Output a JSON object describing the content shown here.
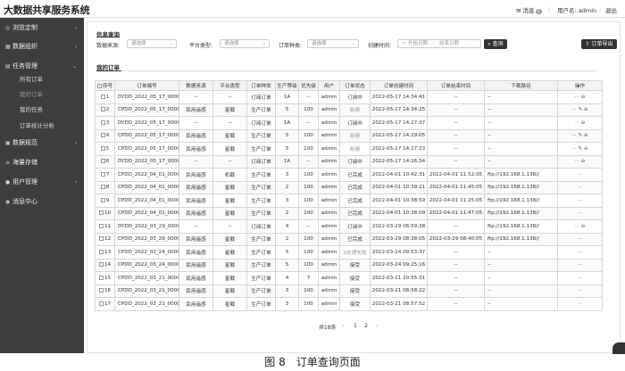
{
  "header": {
    "logo": "大数据共享服务系统",
    "msg_label": "消息",
    "msg_count": "0",
    "user_label": "用户名: admin",
    "exit_label": "退出"
  },
  "sidebar": {
    "items": [
      {
        "label": "浏览定制",
        "arrow": "›"
      },
      {
        "label": "数据组织",
        "arrow": "›"
      },
      {
        "label": "任务管理",
        "arrow": "⌄"
      },
      {
        "label": "所有订单"
      },
      {
        "label": "我的订单"
      },
      {
        "label": "我的任务"
      },
      {
        "label": "订单统计分析"
      },
      {
        "label": "数据规范",
        "arrow": "›"
      },
      {
        "label": "海量存储"
      },
      {
        "label": "用户管理",
        "arrow": "›"
      },
      {
        "label": "消息中心"
      }
    ]
  },
  "filters": {
    "section_title": "信息查询",
    "source_label": "数据来源:",
    "source_ph": "请选择",
    "platform_label": "平台类型:",
    "platform_ph": "请选择",
    "ordertype_label": "订单种类:",
    "ordertype_ph": "请选择",
    "created_label": "创建时间:",
    "start_ph": "开始日期",
    "to": "-",
    "end_ph": "结束日期",
    "search_btn": "查询",
    "export_btn": "订单导出"
  },
  "orders": {
    "section_title": "我的订单",
    "headers": [
      "序号",
      "订单编号",
      "数据来源",
      "平台类型",
      "订单种类",
      "生产等级",
      "优先级",
      "用户",
      "订单状态",
      "订单创建时间",
      "订单结束时间",
      "下载路径",
      "操作"
    ],
    "rows": [
      [
        "1",
        "DYDD_2022_05_17_000002",
        "--",
        "--",
        "订阅订单",
        "1A",
        "--",
        "admin",
        "订阅中",
        "2022-05-17 14:34:41",
        "--",
        "--",
        "···  ⊖"
      ],
      [
        "2",
        "CPDD_2022_05_17_000002",
        "民用遥感",
        "星载",
        "生产订单",
        "5",
        "100",
        "admin",
        "新建",
        "2022-05-17 14:34:25",
        "--",
        "--",
        "···  ✎  ⊖"
      ],
      [
        "3",
        "DYDD_2022_05_17_000001",
        "--",
        "--",
        "订阅订单",
        "1A",
        "--",
        "admin",
        "订阅中",
        "2022-05-17 14:27:37",
        "--",
        "--",
        "···  ⊖"
      ],
      [
        "4",
        "CPDD_2022_05_17_000001",
        "民用遥感",
        "星载",
        "生产订单",
        "5",
        "100",
        "admin",
        "新建",
        "2022-05-17 14:29:05",
        "--",
        "--",
        "···  ✎  ⊖"
      ],
      [
        "5",
        "CPDD_2022_05_17_000000",
        "民用遥感",
        "星载",
        "生产订单",
        "5",
        "100",
        "admin",
        "新建",
        "2022-05-17 14:17:23",
        "--",
        "--",
        "···  ✎  ⊖"
      ],
      [
        "6",
        "DYDD_2022_05_17_000000",
        "--",
        "--",
        "订阅订单",
        "1A",
        "--",
        "admin",
        "订阅中",
        "2022-05-17 14:16:34",
        "--",
        "--",
        "···  ⊖"
      ],
      [
        "7",
        "CPDD_2022_04_01_000003",
        "民用遥感",
        "机载",
        "生产订单",
        "3",
        "100",
        "admin",
        "已完成",
        "2022-04-01 10:42:31",
        "2022-04-01 11:52:05",
        "ftp://192.168.1.138//",
        "···"
      ],
      [
        "8",
        "CPDD_2022_04_01_000002",
        "民用遥感",
        "星载",
        "生产订单",
        "2",
        "100",
        "admin",
        "已完成",
        "2022-04-01 10:39:21",
        "2022-04-01 11:45:05",
        "ftp://192.168.1.138//",
        "···"
      ],
      [
        "9",
        "CPDD_2022_04_01_000001",
        "民用遥感",
        "星载",
        "生产订单",
        "3",
        "100",
        "admin",
        "已完成",
        "2022-04-01 10:38:59",
        "2022-04-01 11:25:05",
        "ftp://192.168.1.138//",
        "···"
      ],
      [
        "10",
        "CPDD_2022_04_01_000001",
        "民用遥感",
        "星载",
        "生产订单",
        "2",
        "100",
        "admin",
        "已完成",
        "2022-04-01 10:38:09",
        "2022-04-01 11:47:05",
        "ftp://192.168.1.138//",
        "···"
      ],
      [
        "11",
        "DYDD_2022_03_29_000000",
        "--",
        "--",
        "订阅订单",
        "4",
        "--",
        "admin",
        "订阅中",
        "2022-03-29 08:59:38",
        "--",
        "ftp://192.168.1.138//",
        "···  ⊖"
      ],
      [
        "12",
        "CPDD_2022_03_29_000000",
        "民用遥感",
        "星载",
        "生产订单",
        "2",
        "100",
        "admin",
        "已完成",
        "2022-03-29 08:38:05",
        "2022-03-29 08:40:05",
        "ftp://192.168.1.138//",
        "···"
      ],
      [
        "13",
        "CPDD_2022_03_24_000001",
        "民用遥感",
        "星载",
        "生产订单",
        "5",
        "100",
        "admin",
        "X处理失败",
        "2022-03-24 09:53:37",
        "--",
        "--",
        "···"
      ],
      [
        "14",
        "CPDD_2022_03_24_000000",
        "民用遥感",
        "星载",
        "生产订单",
        "5",
        "100",
        "admin",
        "接受",
        "2022-03-24 09:25:16",
        "--",
        "--",
        "···"
      ],
      [
        "15",
        "CPDD_2022_03_21_000003",
        "民用遥感",
        "星载",
        "生产订单",
        "4",
        "7",
        "admin",
        "接受",
        "2022-03-21 10:55:31",
        "--",
        "--",
        "···"
      ],
      [
        "16",
        "CPDD_2022_03_21_000002",
        "民用遥感",
        "星载",
        "生产订单",
        "3",
        "100",
        "admin",
        "接受",
        "2022-03-21 08:58:22",
        "--",
        "--",
        "···"
      ],
      [
        "17",
        "CPDD_2022_03_21_000001",
        "民用遥感",
        "星载",
        "生产订单",
        "3",
        "100",
        "admin",
        "接受",
        "2022-03-21 08:57:52",
        "--",
        "--",
        "···"
      ]
    ]
  },
  "pagination": {
    "total": "共18条",
    "prev": "‹",
    "page1": "1",
    "page2": "2",
    "next": "›"
  },
  "caption": "图 8　订单查询页面"
}
